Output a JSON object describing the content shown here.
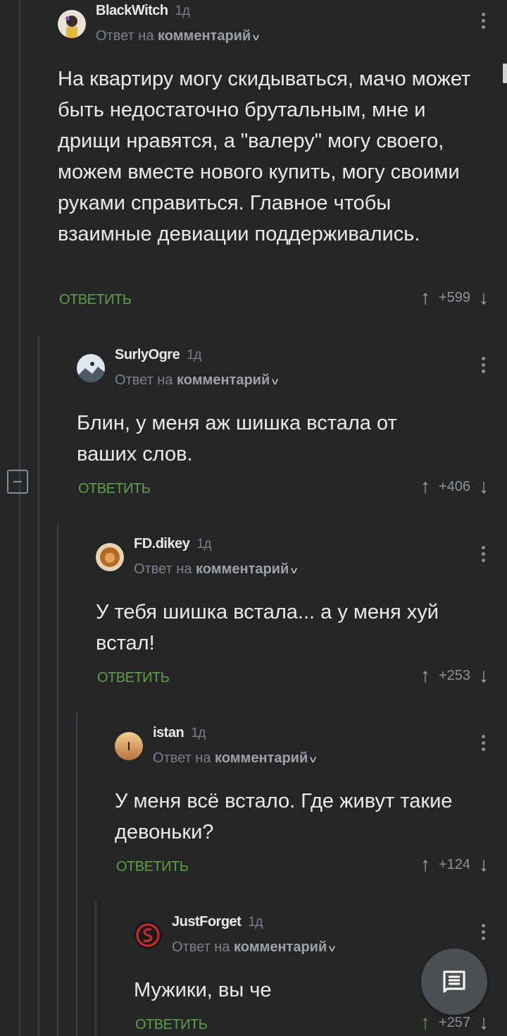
{
  "comments": [
    {
      "author": "BlackWitch",
      "time": "1д",
      "reply_prefix": "Ответ на",
      "reply_target": "комментарий",
      "text": "На квартиру могу скидываться, мачо может быть недостаточно брутальным, мне и дрищи нравятся, а \"валеру\" могу своего, можем вместе нового купить, могу своими руками справиться. Главное чтобы взаимные девиации поддерживались.",
      "reply_label": "ОТВЕТИТЬ",
      "score": "+599"
    },
    {
      "author": "SurlyOgre",
      "time": "1д",
      "reply_prefix": "Ответ на",
      "reply_target": "комментарий",
      "text": "Блин, у меня аж шишка встала от ваших слов.",
      "reply_label": "ОТВЕТИТЬ",
      "score": "+406"
    },
    {
      "author": "FD.dikey",
      "time": "1д",
      "reply_prefix": "Ответ на",
      "reply_target": "комментарий",
      "text": "У тебя шишка встала... а у меня хуй встал!",
      "reply_label": "ОТВЕТИТЬ",
      "score": "+253"
    },
    {
      "author": "istan",
      "time": "1д",
      "reply_prefix": "Ответ на",
      "reply_target": "комментарий",
      "text": "У меня всё встало. Где живут такие девоньки?",
      "reply_label": "ОТВЕТИТЬ",
      "score": "+124"
    },
    {
      "author": "JustForget",
      "time": "1д",
      "reply_prefix": "Ответ на",
      "reply_target": "комментарий",
      "text": "Мужики, вы че",
      "reply_label": "ОТВЕТИТЬ",
      "score": "+257"
    }
  ],
  "icons": {
    "upvote": "arrow-up-icon",
    "downvote": "arrow-down-icon",
    "more": "kebab-menu-icon",
    "collapse": "collapse-minus-icon",
    "compose": "comment-icon"
  },
  "colors": {
    "background": "#242628",
    "reply_button": "#5fa043",
    "text": "#ebebeb",
    "muted": "#7e8184"
  }
}
